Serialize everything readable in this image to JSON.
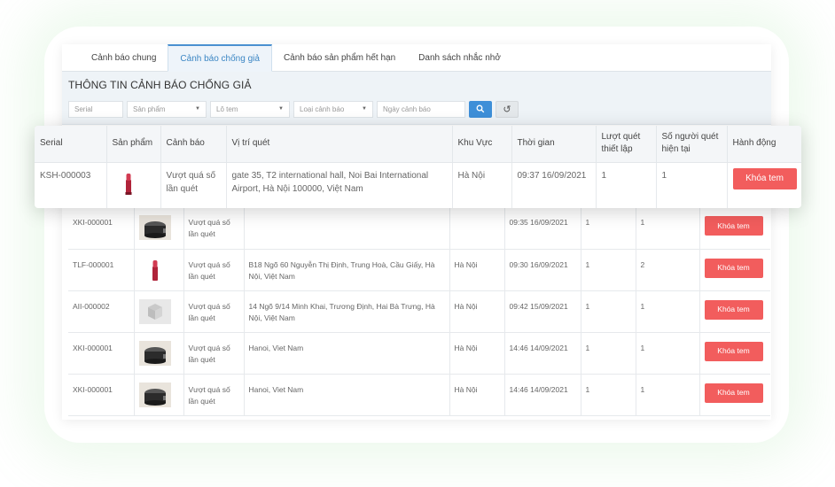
{
  "tabs": [
    "Cảnh báo chung",
    "Cảnh báo chống giả",
    "Cảnh báo sản phẩm hết hạn",
    "Danh sách nhắc nhở"
  ],
  "active_tab": 1,
  "section_title": "THÔNG TIN CẢNH BÁO CHỐNG GIẢ",
  "filters": {
    "serial_placeholder": "Serial",
    "product_placeholder": "Sản phẩm",
    "lot_placeholder": "Lô tem",
    "type_placeholder": "Loại cảnh báo",
    "date_placeholder": "Ngày cảnh báo"
  },
  "columns": {
    "serial": "Serial",
    "product": "Sản phẩm",
    "warning": "Cảnh báo",
    "location": "Vị trí quét",
    "region": "Khu Vực",
    "time": "Thời gian",
    "scan_limit": "Lượt quét thiết lập",
    "scanners": "Số người quét hiện tại",
    "action": "Hành động"
  },
  "highlight_row": {
    "serial": "KSH-000003",
    "product_icon": "lipstick-icon",
    "warning": "Vượt quá số lần quét",
    "location": "gate 35, T2 international hall, Noi Bai International Airport, Hà Nội 100000, Việt Nam",
    "region": "Hà Nội",
    "time": "09:37 16/09/2021",
    "scan_limit": "1",
    "scanners": "1",
    "action": "Khóa tem"
  },
  "rows": [
    {
      "serial": "XKI-000001",
      "product_icon": "rice-cooker-icon",
      "warning": "Vượt quá số lần quét",
      "location": "",
      "region": "",
      "time": "09:35 16/09/2021",
      "scan_limit": "1",
      "scanners": "1",
      "action": "Khóa tem"
    },
    {
      "serial": "TLF-000001",
      "product_icon": "lipstick-icon",
      "warning": "Vượt quá số lần quét",
      "location": "B18 Ngõ 60 Nguyễn Thị Định, Trung Hoà, Cầu Giấy, Hà Nội, Việt Nam",
      "region": "Hà Nội",
      "time": "09:30 16/09/2021",
      "scan_limit": "1",
      "scanners": "2",
      "action": "Khóa tem"
    },
    {
      "serial": "AII-000002",
      "product_icon": "box-icon",
      "warning": "Vượt quá số lần quét",
      "location": "14 Ngõ 9/14 Minh Khai, Trương Định, Hai Bà Trưng, Hà Nội, Việt Nam",
      "region": "Hà Nội",
      "time": "09:42 15/09/2021",
      "scan_limit": "1",
      "scanners": "1",
      "action": "Khóa tem"
    },
    {
      "serial": "XKI-000001",
      "product_icon": "rice-cooker-icon",
      "warning": "Vượt quá số lần quét",
      "location": "Hanoi, Viet Nam",
      "region": "Hà Nội",
      "time": "14:46 14/09/2021",
      "scan_limit": "1",
      "scanners": "1",
      "action": "Khóa tem"
    },
    {
      "serial": "XKI-000001",
      "product_icon": "rice-cooker-icon",
      "warning": "Vượt quá số lần quét",
      "location": "Hanoi, Viet Nam",
      "region": "Hà Nội",
      "time": "14:46 14/09/2021",
      "scan_limit": "1",
      "scanners": "1",
      "action": "Khóa tem"
    }
  ],
  "colors": {
    "accent": "#3e8fd8",
    "danger": "#f25d5d"
  }
}
